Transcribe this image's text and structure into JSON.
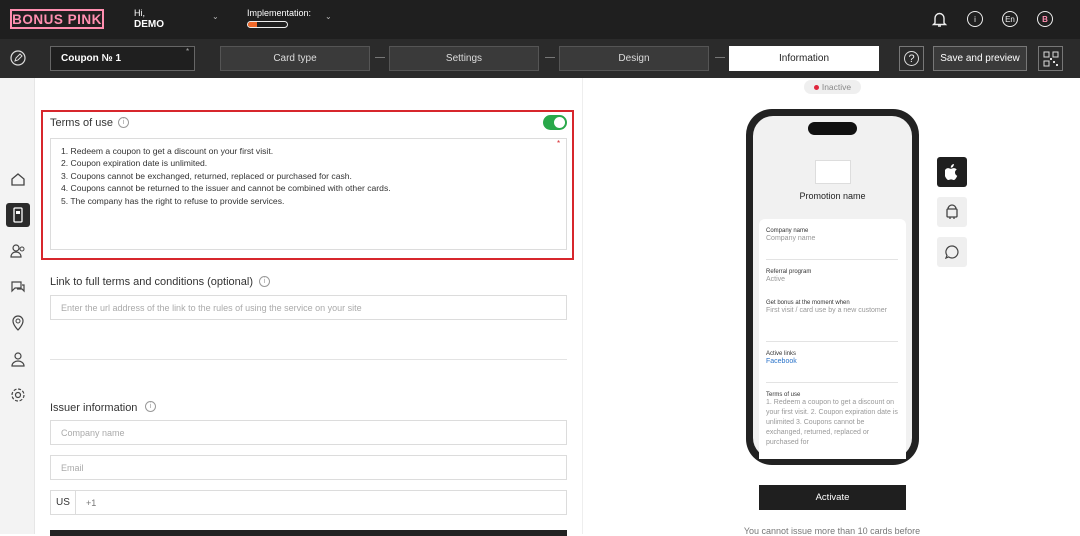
{
  "app": {
    "logo": "BONUS PINK"
  },
  "header": {
    "greeting": "Hi,",
    "user": "DEMO",
    "implementation_label": "Implementation:",
    "implementation_progress": 0.22,
    "language": "En",
    "avatar": "B"
  },
  "toolbar": {
    "coupon_name": "Coupon № 1",
    "steps": [
      "Card type",
      "Settings",
      "Design",
      "Information"
    ],
    "active_step": "Information",
    "help": "?",
    "save_label": "Save and preview"
  },
  "form": {
    "terms_title": "Terms of use",
    "terms_enabled": true,
    "terms_lines": [
      "1. Redeem a coupon to get a discount on your first visit.",
      "2. Coupon expiration date is unlimited.",
      "3. Coupons cannot be exchanged, returned, replaced or purchased for cash.",
      "4. Coupons cannot be returned to the issuer and cannot be combined with other cards.",
      "5. The company has the right to refuse to provide services."
    ],
    "link_title": "Link to full terms and conditions (optional)",
    "link_placeholder": "Enter the url address of the link to the rules of using the service on your site",
    "issuer_title": "Issuer information",
    "company_placeholder": "Company name",
    "email_placeholder": "Email",
    "phone_country": "US",
    "phone_prefix": "+1"
  },
  "preview": {
    "status": "Inactive",
    "promotion_name": "Promotion name",
    "fields": [
      {
        "label": "Company name",
        "value": "Company name"
      },
      {
        "label": "Referral program",
        "value": "Active"
      },
      {
        "label": "Get bonus at the moment when",
        "value": "First visit / card use by a new customer"
      },
      {
        "label": "Active links",
        "value": "Facebook"
      },
      {
        "label": "Terms of use",
        "value": "1. Redeem a coupon to get a discount on your first visit. 2. Coupon expiration date is unlimited 3. Coupons cannot be exchanged, returned, replaced or purchased for"
      }
    ],
    "activate_label": "Activate",
    "note": "You cannot issue more than 10 cards before"
  },
  "colors": {
    "brand_pink": "#ff8fb0",
    "toggle_on": "#29a84a",
    "highlight": "#d7262c",
    "progress": "#f26a2b"
  }
}
